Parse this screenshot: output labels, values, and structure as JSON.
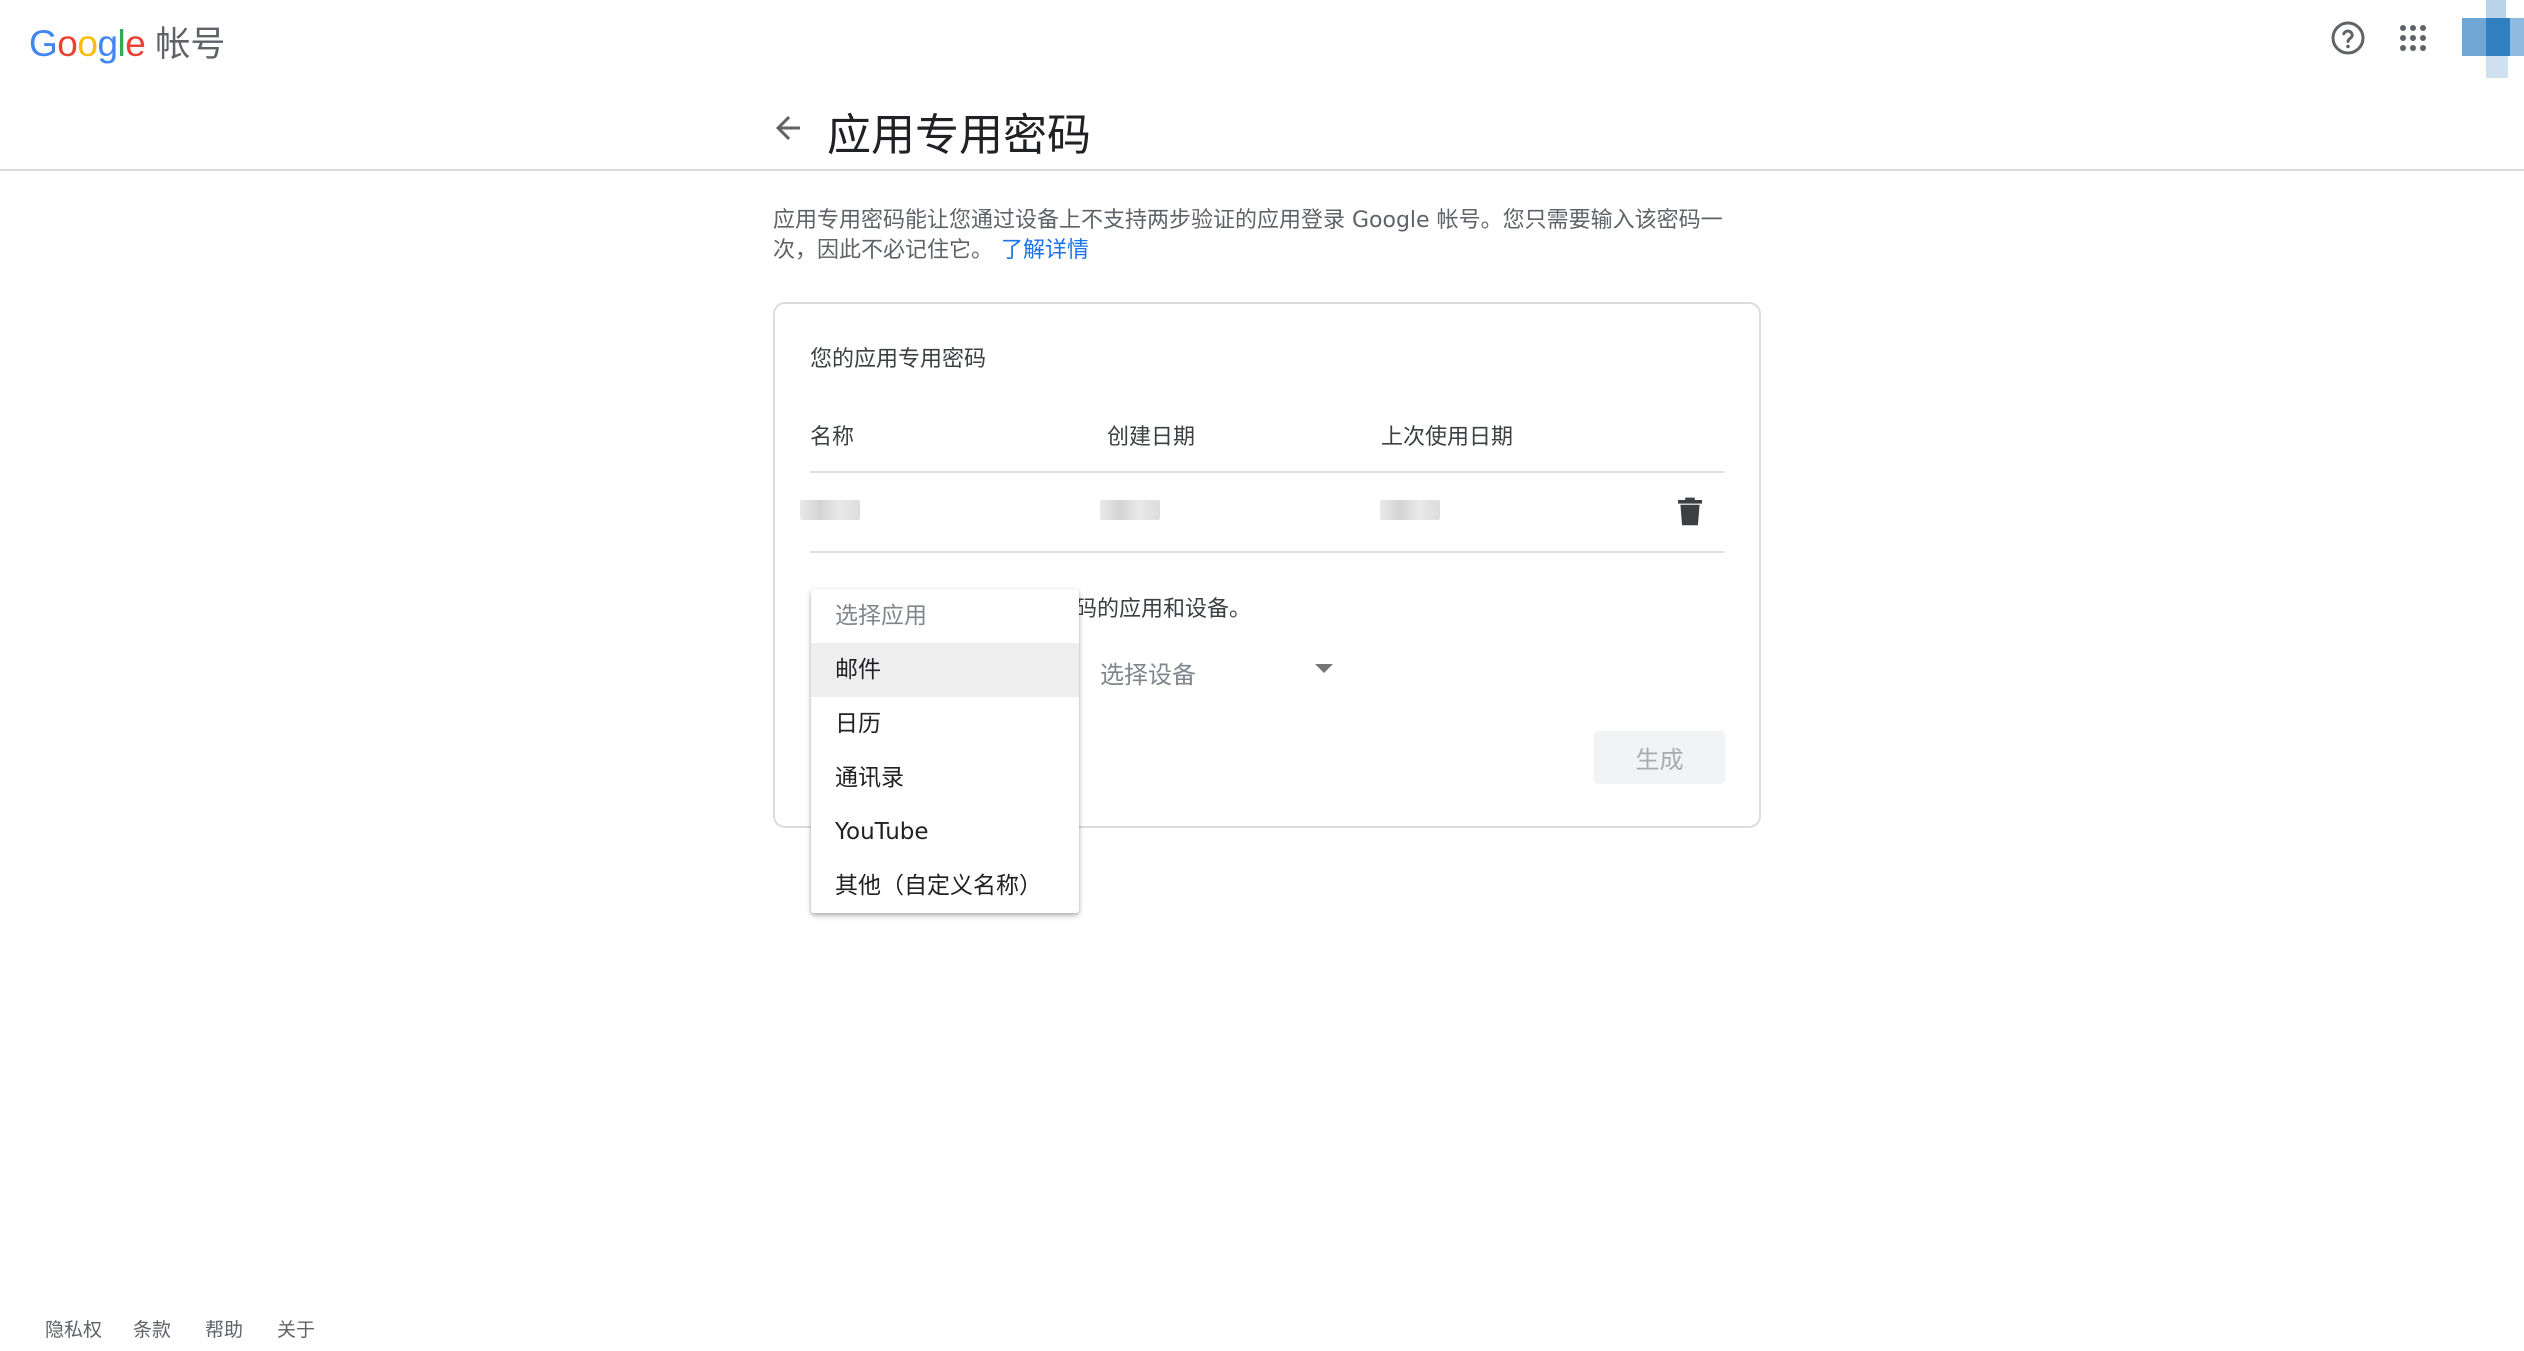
{
  "header": {
    "logo_text": "Google",
    "product_name": "帐号",
    "logo_colors": [
      "#4285F4",
      "#EA4335",
      "#FBBC05",
      "#4285F4",
      "#34A853",
      "#EA4335"
    ]
  },
  "page": {
    "title": "应用专用密码",
    "description": "应用专用密码能让您通过设备上不支持两步验证的应用登录 Google 帐号。您只需要输入该密码一次，因此不必记住它。",
    "learn_more": "了解详情"
  },
  "card": {
    "title": "您的应用专用密码",
    "columns": [
      "名称",
      "创建日期",
      "上次使用日期"
    ],
    "instruction": "码的应用和设备。",
    "device_select_label": "选择设备",
    "generate_label": "生成"
  },
  "app_menu": {
    "header": "选择应用",
    "items": [
      "邮件",
      "日历",
      "通讯录",
      "YouTube",
      "其他（自定义名称）"
    ],
    "highlighted_index": 0
  },
  "footer": {
    "links": [
      "隐私权",
      "条款",
      "帮助",
      "关于"
    ]
  },
  "colors": {
    "link": "#1a73e8",
    "divider": "#dadce0",
    "text_secondary": "#5f6368"
  }
}
